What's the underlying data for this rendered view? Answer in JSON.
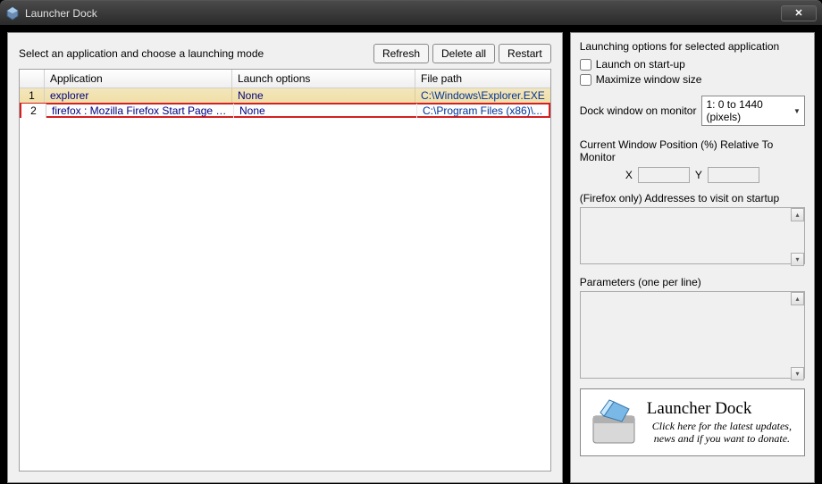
{
  "window": {
    "title": "Launcher Dock"
  },
  "main": {
    "instruction": "Select an application and choose a launching mode",
    "buttons": {
      "refresh": "Refresh",
      "delete_all": "Delete all",
      "restart": "Restart"
    },
    "table": {
      "headers": {
        "application": "Application",
        "launch_options": "Launch options",
        "file_path": "File path"
      },
      "rows": [
        {
          "num": "1",
          "app": "explorer",
          "launch": "None",
          "path": "C:\\Windows\\Explorer.EXE"
        },
        {
          "num": "2",
          "app": "firefox : Mozilla Firefox Start Page - Moz...",
          "launch": "None",
          "path": "C:\\Program Files (x86)\\..."
        }
      ]
    }
  },
  "right": {
    "title": "Launching options for selected application",
    "launch_on_startup": "Launch on start-up",
    "maximize": "Maximize window size",
    "dock_label": "Dock window on monitor",
    "dock_value": "1: 0 to 1440 (pixels)",
    "pos_label": "Current Window Position (%) Relative To Monitor",
    "x_label": "X",
    "y_label": "Y",
    "x_value": "",
    "y_value": "",
    "addresses_label": "(Firefox only) Addresses to visit on startup",
    "addresses_value": "",
    "params_label": "Parameters  (one per line)",
    "params_value": "",
    "promo": {
      "title": "Launcher Dock",
      "sub": "Click here for the latest updates, news and if you want to donate."
    }
  }
}
